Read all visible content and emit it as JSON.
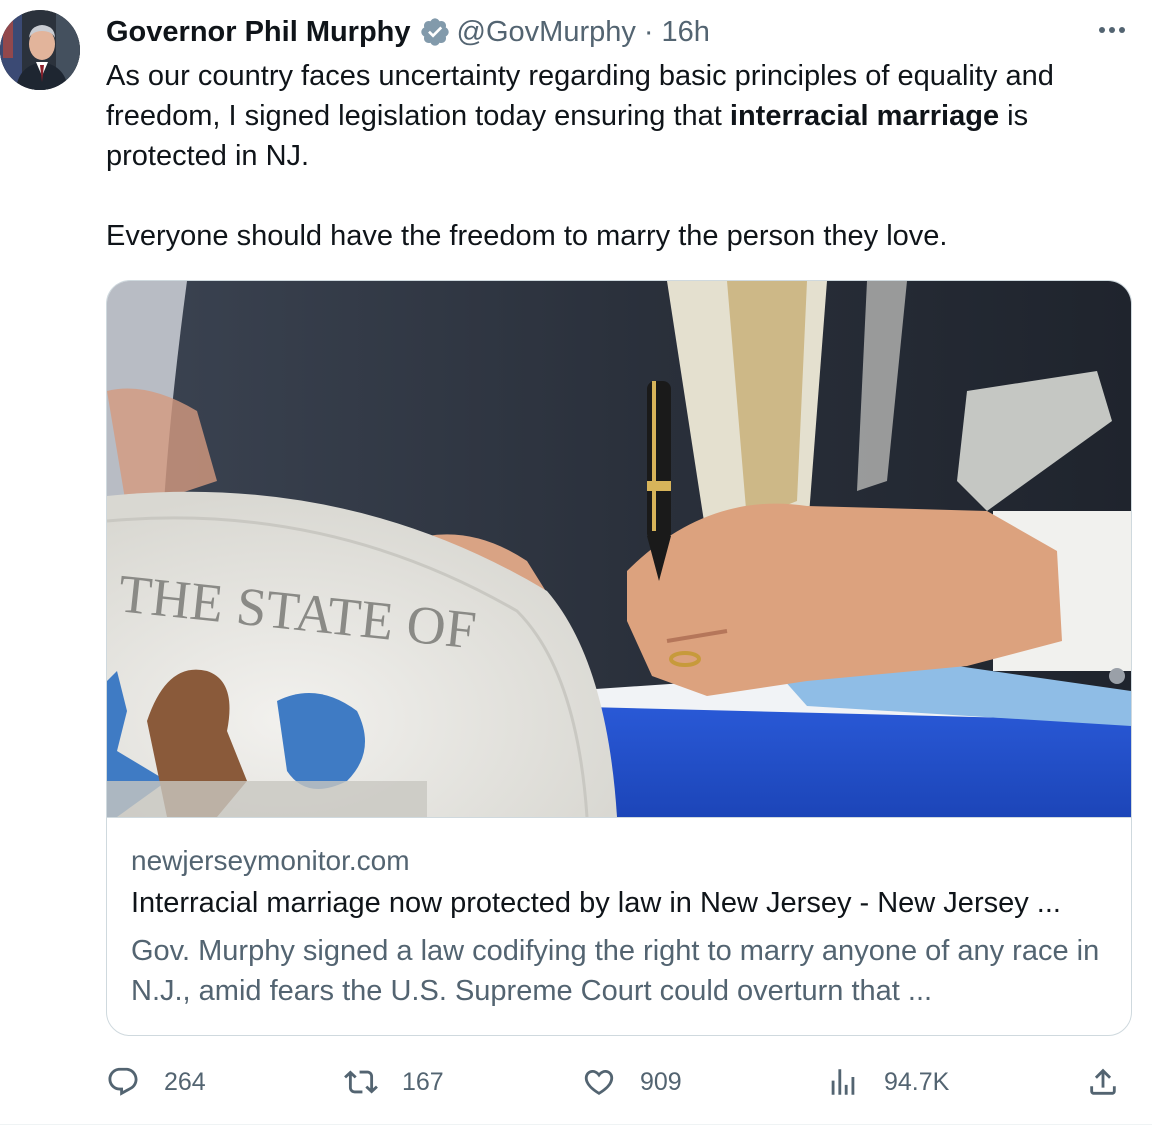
{
  "author": {
    "name": "Governor Phil Murphy",
    "handle": "@GovMurphy",
    "separator": "·",
    "time": "16h",
    "avatar_icon": "avatar-governor-photo",
    "verified_icon": "verified-badge-icon"
  },
  "tweet": {
    "line1_pre": "As our country faces uncertainty regarding basic principles of equality and freedom, I signed legislation today ensuring that ",
    "line1_bold": "interracial marriage",
    "line1_post": " is protected in NJ.",
    "line2": "Everyone should have the freedom to marry the person they love."
  },
  "card": {
    "domain": "newjerseymonitor.com",
    "title": "Interracial marriage now protected by law in New Jersey - New Jersey ...",
    "description": "Gov. Murphy signed a law codifying the right to marry anyone of any race in N.J., amid fears the U.S. Supreme Court could overturn that ...",
    "seal_text": "THE STATE OF"
  },
  "actions": {
    "replies": "264",
    "retweets": "167",
    "likes": "909",
    "views": "94.7K"
  },
  "colors": {
    "text": "#0f1419",
    "secondary": "#536471",
    "border": "#cfd9de",
    "verified_gray": "#829aab"
  }
}
